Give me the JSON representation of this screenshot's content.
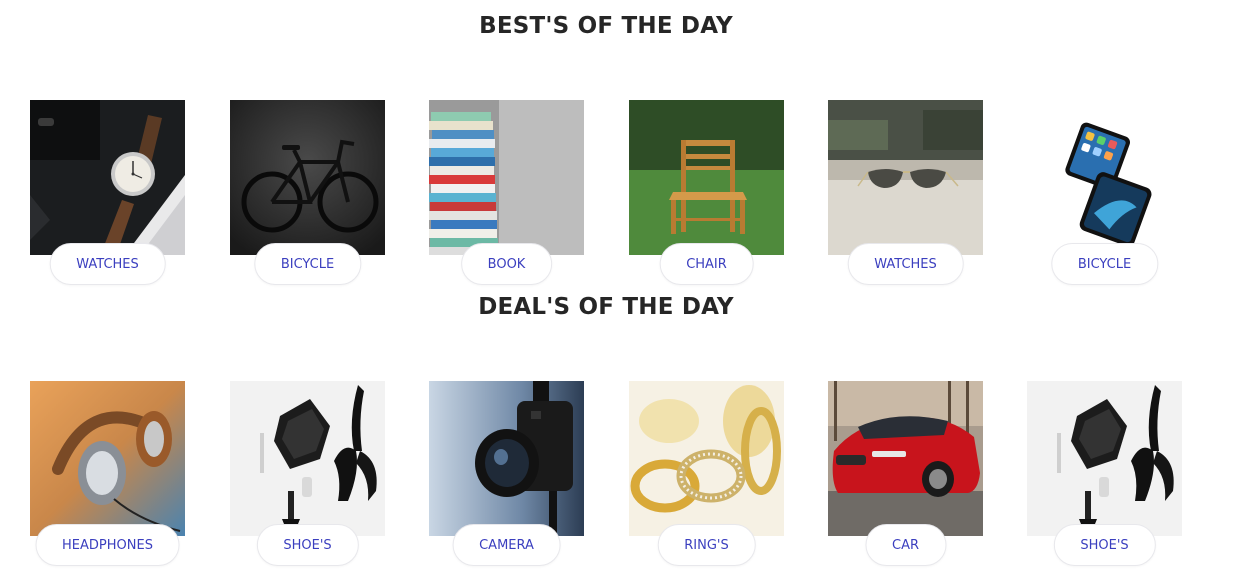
{
  "sections": {
    "best": {
      "title": "BEST'S OF THE DAY",
      "items": [
        {
          "label": "WATCHES",
          "image": "wristwatch"
        },
        {
          "label": "BICYCLE",
          "image": "bicycle"
        },
        {
          "label": "BOOK",
          "image": "book-stack"
        },
        {
          "label": "CHAIR",
          "image": "wooden-chair"
        },
        {
          "label": "WATCHES",
          "image": "sunglasses"
        },
        {
          "label": "BICYCLE",
          "image": "smartphones"
        }
      ]
    },
    "deals": {
      "title": "DEAL'S OF THE DAY",
      "items": [
        {
          "label": "HEADPHONES",
          "image": "headphones"
        },
        {
          "label": "SHOE'S",
          "image": "high-heels-and-bag"
        },
        {
          "label": "CAMERA",
          "image": "camera"
        },
        {
          "label": "RING'S",
          "image": "gold-rings"
        },
        {
          "label": "CAR",
          "image": "red-car"
        },
        {
          "label": "SHOE'S",
          "image": "high-heels-and-bag"
        }
      ]
    }
  },
  "colors": {
    "heading": "#262626",
    "pill_text": "#3b3fbf",
    "pill_border": "#e8e8ec",
    "background": "#ffffff"
  }
}
